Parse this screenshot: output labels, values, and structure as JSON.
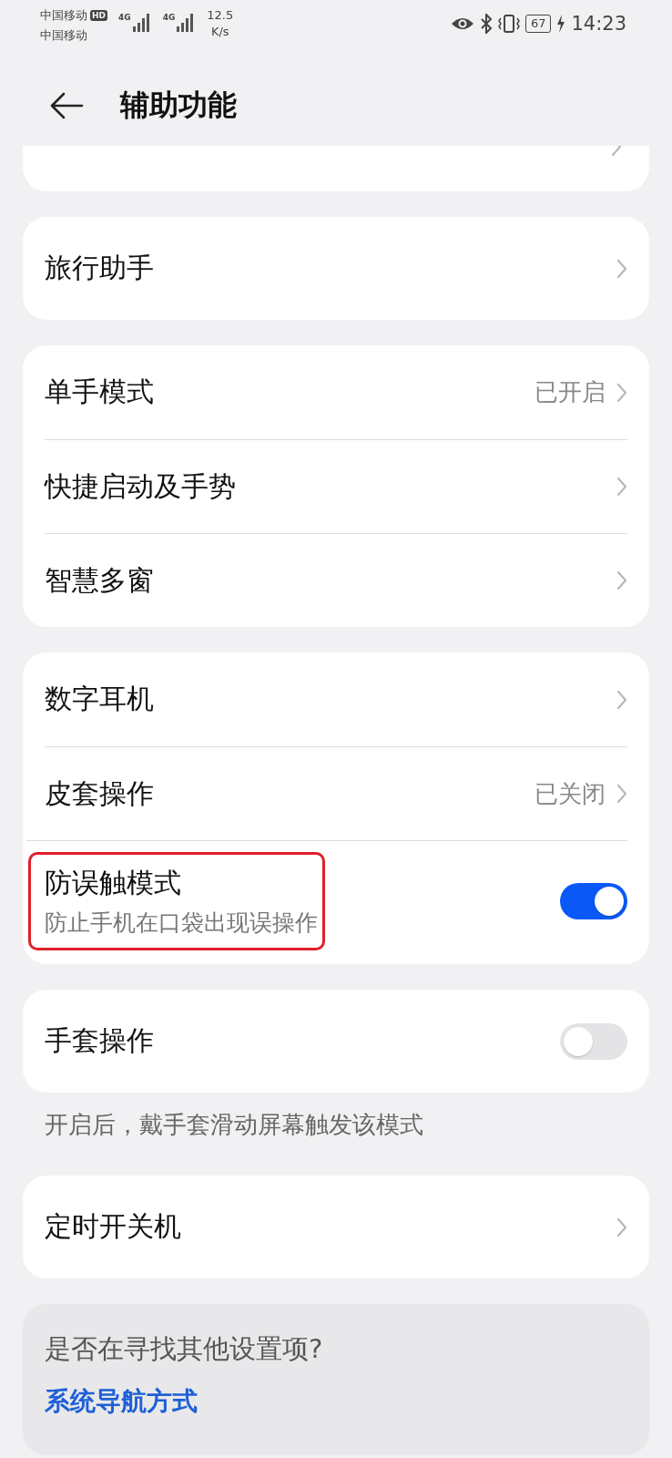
{
  "status_bar": {
    "carrier_1": "中国移动",
    "hd_badge": "HD",
    "carrier_2": "中国移动",
    "network_1": "4G",
    "network_2": "4G",
    "speed_value": "12.5",
    "speed_unit": "K/s",
    "battery": "67",
    "time": "14:23"
  },
  "header": {
    "title": "辅助功能"
  },
  "groups": [
    {
      "kind": "sliver"
    },
    {
      "kind": "card",
      "rows": [
        {
          "kind": "nav",
          "label": "旅行助手"
        }
      ]
    },
    {
      "kind": "card",
      "rows": [
        {
          "kind": "nav",
          "label": "单手模式",
          "value": "已开启"
        },
        {
          "kind": "nav",
          "label": "快捷启动及手势"
        },
        {
          "kind": "nav",
          "label": "智慧多窗"
        }
      ]
    },
    {
      "kind": "card",
      "rows": [
        {
          "kind": "nav",
          "label": "数字耳机"
        },
        {
          "kind": "nav",
          "label": "皮套操作",
          "value": "已关闭"
        },
        {
          "kind": "toggle",
          "label": "防误触模式",
          "sublabel": "防止手机在口袋出现误操作",
          "on": true,
          "highlighted": true
        }
      ]
    },
    {
      "kind": "card",
      "rows": [
        {
          "kind": "toggle",
          "label": "手套操作",
          "on": false,
          "highlighted": false
        }
      ],
      "note": "开启后，戴手套滑动屏幕触发该模式"
    },
    {
      "kind": "card",
      "rows": [
        {
          "kind": "nav",
          "label": "定时开关机"
        }
      ]
    }
  ],
  "suggestion": {
    "question": "是否在寻找其他设置项?",
    "link": "系统导航方式"
  }
}
